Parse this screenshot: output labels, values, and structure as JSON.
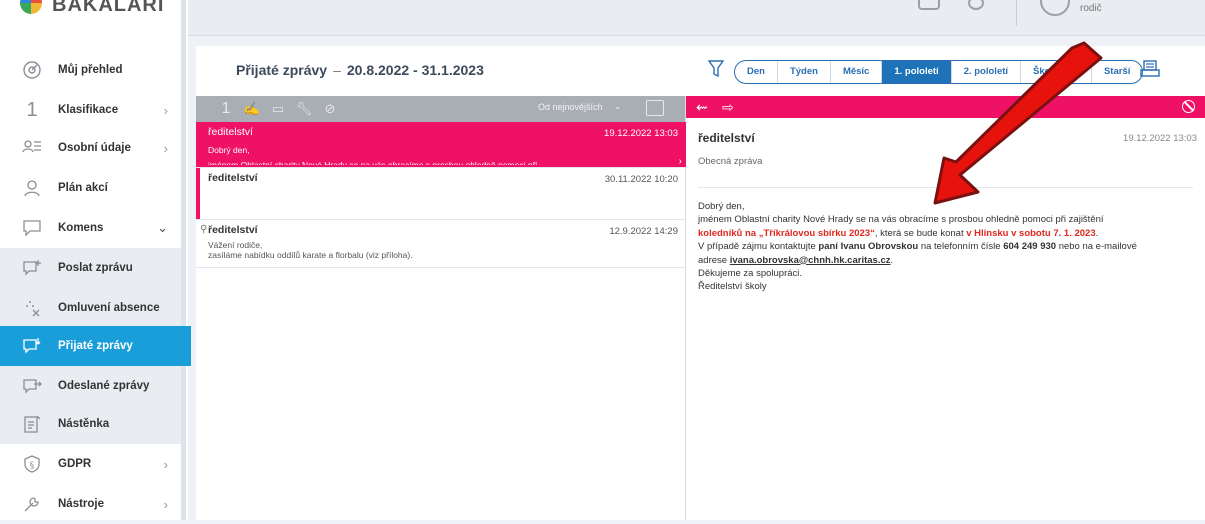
{
  "brand": {
    "name": "BAKALÁŘI"
  },
  "user": {
    "role": "rodič"
  },
  "sidebar": {
    "items": [
      {
        "label": "Můj přehled",
        "icon": "dashboard-icon",
        "chevron": ""
      },
      {
        "label": "Klasifikace",
        "icon": "grade-icon",
        "chevron": ">"
      },
      {
        "label": "Osobní údaje",
        "icon": "personal-data-icon",
        "chevron": ">"
      },
      {
        "label": "Plán akcí",
        "icon": "events-plan-icon",
        "chevron": ""
      },
      {
        "label": "Komens",
        "icon": "komens-icon",
        "chevron": "v"
      },
      {
        "label": "Poslat zprávu",
        "icon": "send-message-icon",
        "chevron": ""
      },
      {
        "label": "Omluvení absence",
        "icon": "absence-excuse-icon",
        "chevron": ""
      },
      {
        "label": "Přijaté zprávy",
        "icon": "received-messages-icon",
        "chevron": ""
      },
      {
        "label": "Odeslané zprávy",
        "icon": "sent-messages-icon",
        "chevron": ""
      },
      {
        "label": "Nástěnka",
        "icon": "noticeboard-icon",
        "chevron": ""
      },
      {
        "label": "GDPR",
        "icon": "gdpr-icon",
        "chevron": ">"
      },
      {
        "label": "Nástroje",
        "icon": "tools-icon",
        "chevron": ">"
      }
    ],
    "active_index": 7
  },
  "header": {
    "title": "Přijaté zprávy",
    "range": "20.8.2022 - 31.1.2023",
    "periods": [
      "Den",
      "Týden",
      "Měsíc",
      "1. pololetí",
      "2. pololetí",
      "Školní rok",
      "Starší"
    ],
    "active_period": "1. pololetí"
  },
  "list": {
    "toolbar_number": "1",
    "sort_label": "Od nejnovějších",
    "messages": [
      {
        "sender": "ředitelství",
        "date": "19.12.2022 13:03",
        "preview_line1": "Dobrý den,",
        "preview_line2": "jménem Oblastní charity Nové Hrady se na vás obracíme s prosbou ohledně pomoci při",
        "selected": true
      },
      {
        "sender": "ředitelství",
        "date": "30.11.2022 10:20",
        "preview_line1": "",
        "preview_line2": "",
        "unread": true
      },
      {
        "sender": "ředitelství",
        "date": "12.9.2022 14:29",
        "preview_line1": "Vážení rodiče,",
        "preview_line2": "zasíláme nabídku oddílů karate a florbalu (viz příloha).",
        "has_attachment": true
      }
    ]
  },
  "detail": {
    "sender": "ředitelství",
    "date": "19.12.2022 13:03",
    "type": "Obecná zpráva",
    "body": {
      "greeting": "Dobrý den,",
      "l2": "jménem Oblastní charity Nové Hrady se na vás obracíme s  prosbou ohledně pomoci při  zajištění",
      "l3_red1": "koledníků na „Tříkrálovou sbírku 2023“",
      "l3_mid": ", která se bude konat ",
      "l3_red2": "v Hlinsku v sobotu 7. 1. 2023",
      "l3_end": ".",
      "l4_a": "V případě zájmu kontaktujte ",
      "l4_name": "paní Ivanu Obrovskou",
      "l4_b": " na telefonním čísle ",
      "l4_phone": "604 249 930",
      "l4_c": " nebo na e-mailové",
      "l5_a": "adrese  ",
      "l5_email": "ivana.obrovska@chnh.hk.caritas.cz",
      "l5_end": ".",
      "l6": "Děkujeme za spolupráci.",
      "l7": "Ředitelství školy"
    }
  },
  "colors": {
    "accent_pink": "#ee1166",
    "active_blue": "#1a9ed9",
    "period_blue": "#1e73b8",
    "annotation_red": "#e8120c"
  }
}
